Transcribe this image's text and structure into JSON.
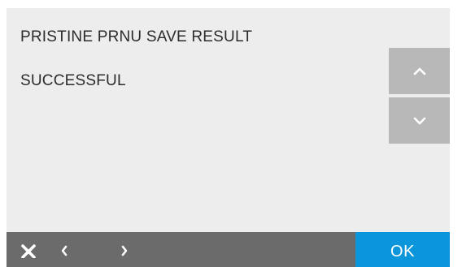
{
  "screen": {
    "title": "PRISTINE PRNU SAVE RESULT",
    "status": "SUCCESSFUL"
  },
  "scroll": {
    "up_icon": "chevron-up-icon",
    "down_icon": "chevron-down-icon"
  },
  "footer": {
    "close_icon": "close-icon",
    "back_icon": "chevron-left-icon",
    "forward_icon": "chevron-right-icon",
    "ok_label": "OK"
  },
  "colors": {
    "panel_background": "#ededed",
    "text": "#2c2c2c",
    "scroll_button": "#b8b8b8",
    "footer_bar": "#6b6b6b",
    "accent_ok": "#0b96dc"
  }
}
